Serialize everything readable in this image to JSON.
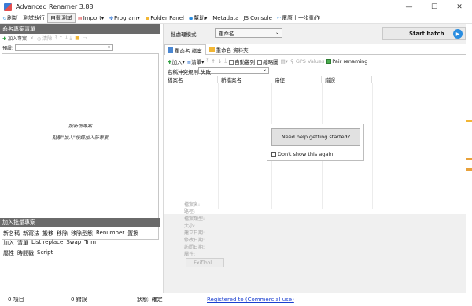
{
  "window": {
    "title": "Advanced Renamer 3.88",
    "controls": [
      "—",
      "☐",
      "✕"
    ]
  },
  "menubar": [
    {
      "label": "刷新",
      "icon": "refresh-icon"
    },
    {
      "label": "測試執行"
    },
    {
      "label": "自動測試",
      "active": true
    },
    {
      "label": "Import",
      "icon": "import-icon"
    },
    {
      "label": "Program",
      "icon": "program-icon"
    },
    {
      "label": "Folder Panel",
      "icon": "folder-icon"
    },
    {
      "label": "幫助",
      "icon": "help-icon"
    },
    {
      "label": "Metadata"
    },
    {
      "label": "JS Console"
    },
    {
      "label": "還原上一步動作",
      "icon": "undo-icon"
    }
  ],
  "left_panel": {
    "header": "命名專案清單",
    "toolbar": {
      "add": "加入專案",
      "remove": "×",
      "clear": "清除",
      "move_arrows": "⤒ ↑ ↓ ⤓"
    },
    "preset_label": "預設:",
    "empty_line1": "按新增專案.",
    "empty_line2": "點擊\"加入\"按鈕加入新專案."
  },
  "batch_panel": {
    "header": "加入批量專案",
    "row1": [
      "新名稱",
      "新寫法",
      "搬移",
      "移除",
      "移除型態",
      "Renumber",
      "置換"
    ],
    "row2": [
      "加入",
      "清單",
      "List replace",
      "Swap",
      "Trim"
    ],
    "row3": [
      "屬性",
      "時間戳",
      "Script"
    ]
  },
  "statusbar": {
    "items": "0 項目",
    "errors": "0 錯誤",
    "state": "狀態: 確定",
    "registered": "Registered to  (Commercial use)"
  },
  "main": {
    "mode_label": "批處理模式",
    "mode_value": "重命名",
    "start_batch": "Start batch",
    "tabs": [
      "重命名 檔案",
      "重命名 資料夾"
    ],
    "file_toolbar": {
      "add": "加入",
      "list": "清單",
      "auto_size": "自動叢列",
      "thumbnail": "縮略圖",
      "gps": "GPS Values",
      "pair": "Pair renaming"
    },
    "conflict_label": "名稱沖突規則:",
    "conflict_value": "失敗",
    "columns": [
      "檔案名",
      "新檔案名",
      "路徑",
      "錯誤"
    ],
    "help_button": "Need help getting started?",
    "help_checkbox": "Don't show this again",
    "properties": [
      "檔案名:",
      "路徑:",
      "檔案類型:",
      "大小:",
      "建立日期:",
      "修改日期:",
      "訪問日期:",
      "屬性:"
    ],
    "exif_button": "ExifTool..."
  },
  "colors": {
    "panel_header": "#6a6a6a",
    "start_icon": "#2a8de0",
    "link": "#1a3fd0"
  }
}
